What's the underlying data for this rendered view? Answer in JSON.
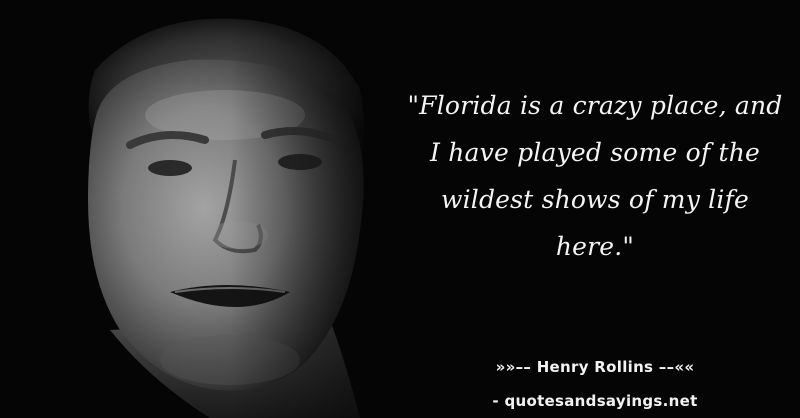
{
  "image": {
    "subject": "portrait-photo",
    "background_color": "#050505",
    "skin_color": "#8a8a8a"
  },
  "quote": {
    "text": "\"Florida is a crazy place, and I have played some of the wildest shows of my life here.\""
  },
  "attribution": {
    "author_line": "»»–– Henry Rollins ––««",
    "source_line": "- quotesandsayings.net"
  }
}
